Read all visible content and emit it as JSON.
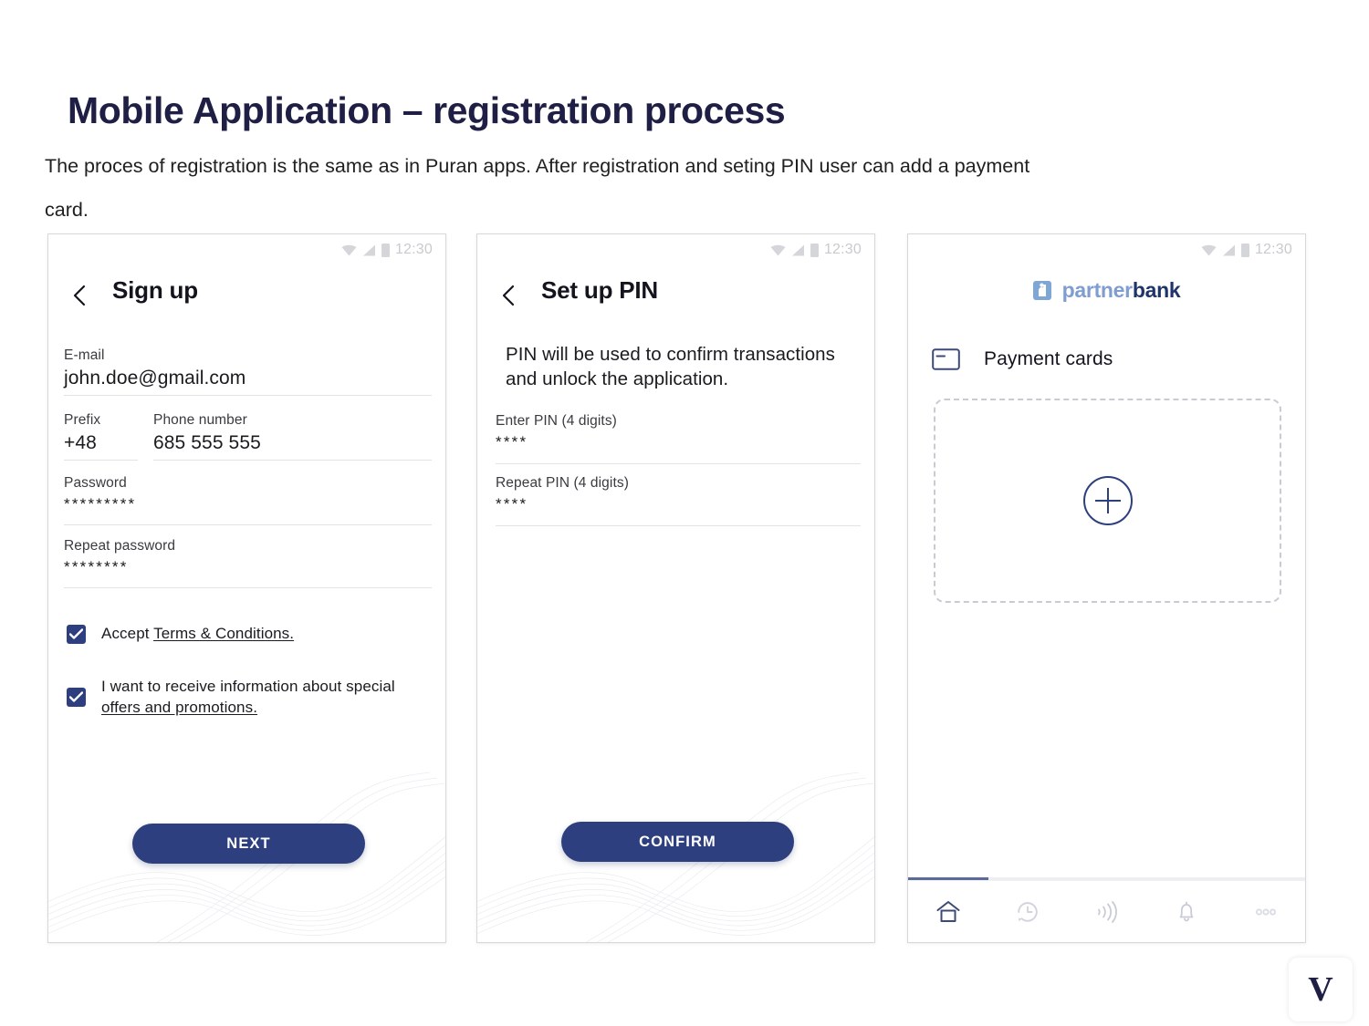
{
  "header": {
    "title": "Mobile Application – registration process",
    "subtitle_line1": "The proces of registration is the same as in Puran apps. After registration and seting PIN user can add a payment",
    "subtitle_line2": "card."
  },
  "colors": {
    "title": "#1f1f45",
    "primary": "#2e3f7f",
    "brand_light": "#7f9dd0",
    "brand_dark": "#1f3468",
    "rule": "#e3e3e6",
    "dashed_border": "#c9cbd4",
    "status_gray": "#c9cacf"
  },
  "status_bar": {
    "time": "12:30",
    "icons": [
      "wifi-icon",
      "signal-icon",
      "battery-icon"
    ]
  },
  "screens": [
    {
      "id": "sign-up",
      "back_icon": "chevron-left-icon",
      "title": "Sign up",
      "fields": [
        {
          "label": "E-mail",
          "value": "john.doe@gmail.com",
          "masked": false
        },
        {
          "label": "Prefix",
          "value": "+48",
          "masked": false
        },
        {
          "label": "Phone number",
          "value": "685 555 555",
          "masked": false
        },
        {
          "label": "Password",
          "value": "*********",
          "masked": true
        },
        {
          "label": "Repeat password",
          "value": "********",
          "masked": true
        }
      ],
      "checkboxes": [
        {
          "checked": true,
          "text_before": "Accept ",
          "link": "Terms & Conditions.",
          "text_after": ""
        },
        {
          "checked": true,
          "text_before": "I want to receive information about special ",
          "link": "offers and promotions.",
          "text_after": ""
        }
      ],
      "button": {
        "label": "NEXT"
      }
    },
    {
      "id": "set-up-pin",
      "back_icon": "chevron-left-icon",
      "title": "Set up PIN",
      "description": "PIN will be used to confirm transactions and unlock the application.",
      "fields": [
        {
          "label": "Enter PIN (4 digits)",
          "value": "****",
          "masked": true
        },
        {
          "label": "Repeat PIN (4 digits)",
          "value": "****",
          "masked": true
        }
      ],
      "button": {
        "label": "CONFIRM"
      }
    },
    {
      "id": "payment-cards",
      "brand": {
        "mark_icon": "partnerbank-mark-icon",
        "name_part1": "partner",
        "name_part2": "bank"
      },
      "section": {
        "icon": "credit-card-icon",
        "label": "Payment cards"
      },
      "add_card": {
        "icon": "plus-circle-icon"
      },
      "nav_items": [
        {
          "icon": "home-icon",
          "active": true
        },
        {
          "icon": "history-clock-icon",
          "active": false
        },
        {
          "icon": "contactless-icon",
          "active": false
        },
        {
          "icon": "bell-icon",
          "active": false
        },
        {
          "icon": "more-dots-icon",
          "active": false
        }
      ]
    }
  ],
  "watermark": {
    "label": "V"
  }
}
